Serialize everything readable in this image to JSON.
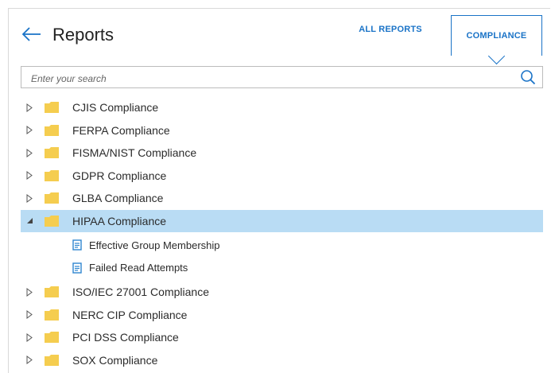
{
  "header": {
    "title": "Reports",
    "tabs": [
      {
        "label": "ALL REPORTS",
        "active": false
      },
      {
        "label": "COMPLIANCE",
        "active": true
      }
    ]
  },
  "search": {
    "placeholder": "Enter your search",
    "value": ""
  },
  "tree": {
    "folders": [
      {
        "label": "CJIS Compliance",
        "expanded": false
      },
      {
        "label": "FERPA Compliance",
        "expanded": false
      },
      {
        "label": "FISMA/NIST Compliance",
        "expanded": false
      },
      {
        "label": "GDPR Compliance",
        "expanded": false
      },
      {
        "label": "GLBA Compliance",
        "expanded": false
      },
      {
        "label": "HIPAA Compliance",
        "expanded": true,
        "selected": true,
        "children": [
          "Effective Group Membership",
          "Failed Read Attempts"
        ]
      },
      {
        "label": "ISO/IEC 27001 Compliance",
        "expanded": false
      },
      {
        "label": "NERC CIP Compliance",
        "expanded": false
      },
      {
        "label": "PCI DSS Compliance",
        "expanded": false
      },
      {
        "label": "SOX Compliance",
        "expanded": false
      }
    ]
  },
  "colors": {
    "accent": "#1a73c7",
    "selected_row": "#b9dcf4",
    "folder": "#f5cd4f",
    "report_icon": "#2f86d0"
  },
  "icons": {
    "back": "arrow-left-icon",
    "search": "search-icon",
    "collapsed": "triangle-right-icon",
    "expanded": "triangle-down-icon",
    "folder": "folder-icon",
    "report": "report-document-icon"
  }
}
